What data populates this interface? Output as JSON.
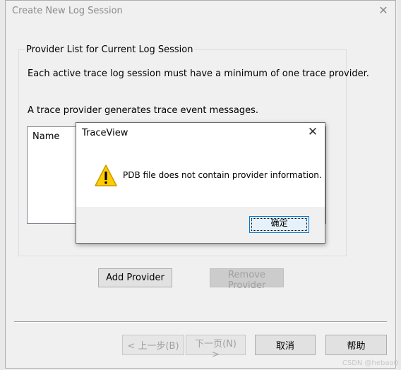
{
  "wizard": {
    "title": "Create New Log Session",
    "group_label": "Provider List for Current Log Session",
    "line1": "Each active trace log session must have a minimum of one trace provider.",
    "line2": "A trace provider generates trace event messages.",
    "list_header": "Name",
    "add_provider_label": "Add Provider",
    "remove_provider_label": "Remove Provider",
    "back_label": "< 上一步(B)",
    "next_label": "下一页(N) >",
    "cancel_label": "取消",
    "help_label": "帮助"
  },
  "dialog": {
    "title": "TraceView",
    "message": "PDB file does not contain provider information.",
    "ok_label": "确定",
    "icon": "warning-icon"
  },
  "watermark": "CSDN @hebao0",
  "colors": {
    "accent": "#0078d7",
    "warning": "#ffcc00"
  }
}
